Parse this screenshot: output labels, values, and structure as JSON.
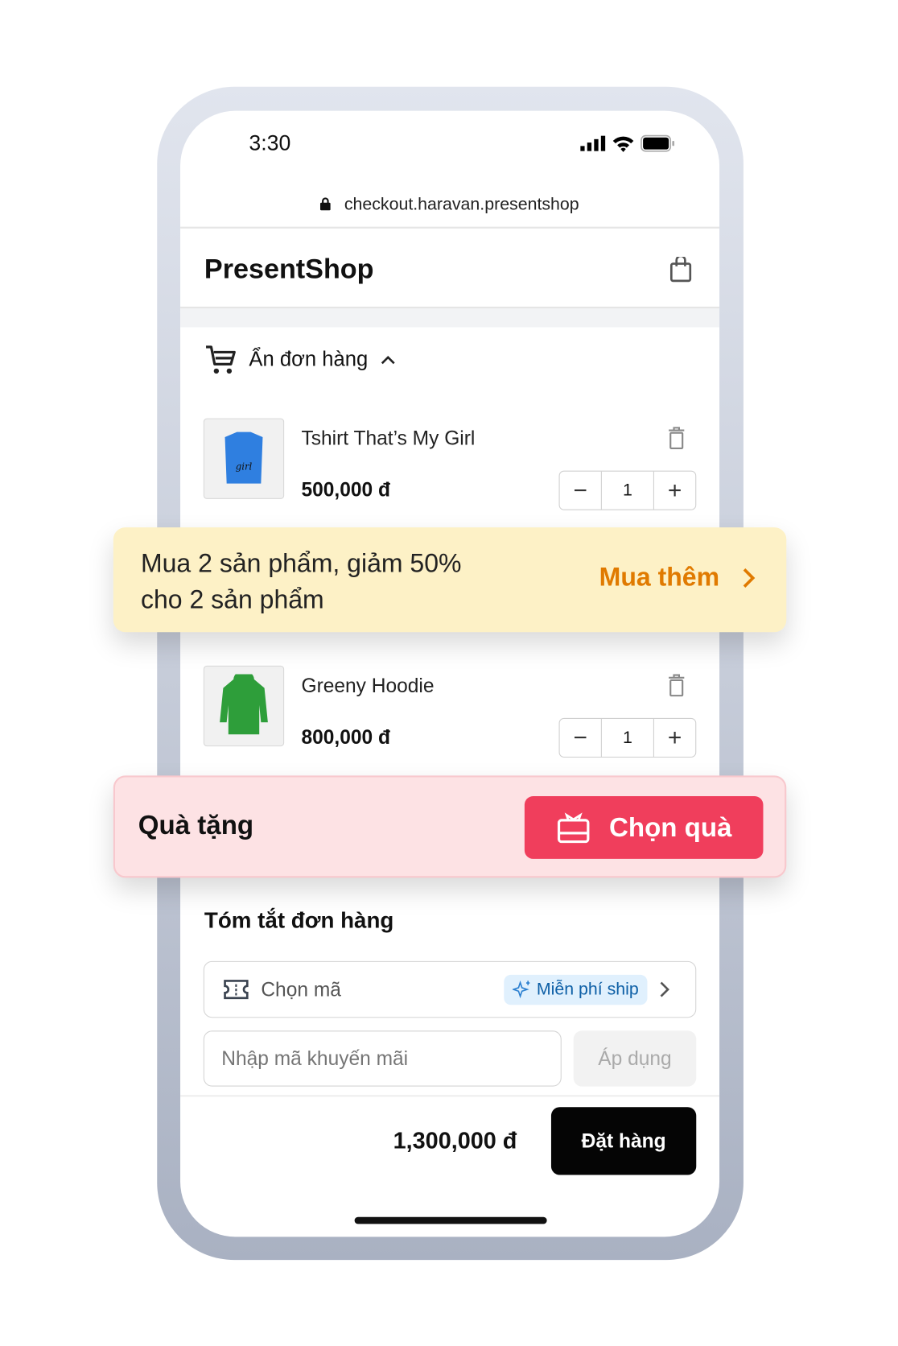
{
  "status_bar": {
    "time": "3:30"
  },
  "browser": {
    "url": "checkout.haravan.presentshop"
  },
  "header": {
    "brand": "PresentShop"
  },
  "order": {
    "toggle_label": "Ẩn đơn hàng",
    "items": [
      {
        "name": "Tshirt That’s My Girl",
        "price": "500,000 đ",
        "quantity": "1",
        "color": "#2f7fe0"
      },
      {
        "name": "Greeny Hoodie",
        "price": "800,000 đ",
        "quantity": "1",
        "color": "#2e9e3a"
      }
    ]
  },
  "promo_banner": {
    "line1": "Mua 2 sản phẩm, giảm 50%",
    "line2": "cho 2 sản phẩm",
    "action": "Mua thêm",
    "accent": "#e07a00"
  },
  "gift_banner": {
    "label": "Quà tặng",
    "button": "Chọn quà",
    "accent": "#f03e5c"
  },
  "summary": {
    "title": "Tóm tắt đơn hàng",
    "voucher_label": "Chọn mã",
    "voucher_badge": "Miễn phí ship",
    "promo_placeholder": "Nhập mã khuyến mãi",
    "apply_label": "Áp dụng",
    "total": "1,300,000 đ",
    "checkout_label": "Đặt hàng"
  }
}
